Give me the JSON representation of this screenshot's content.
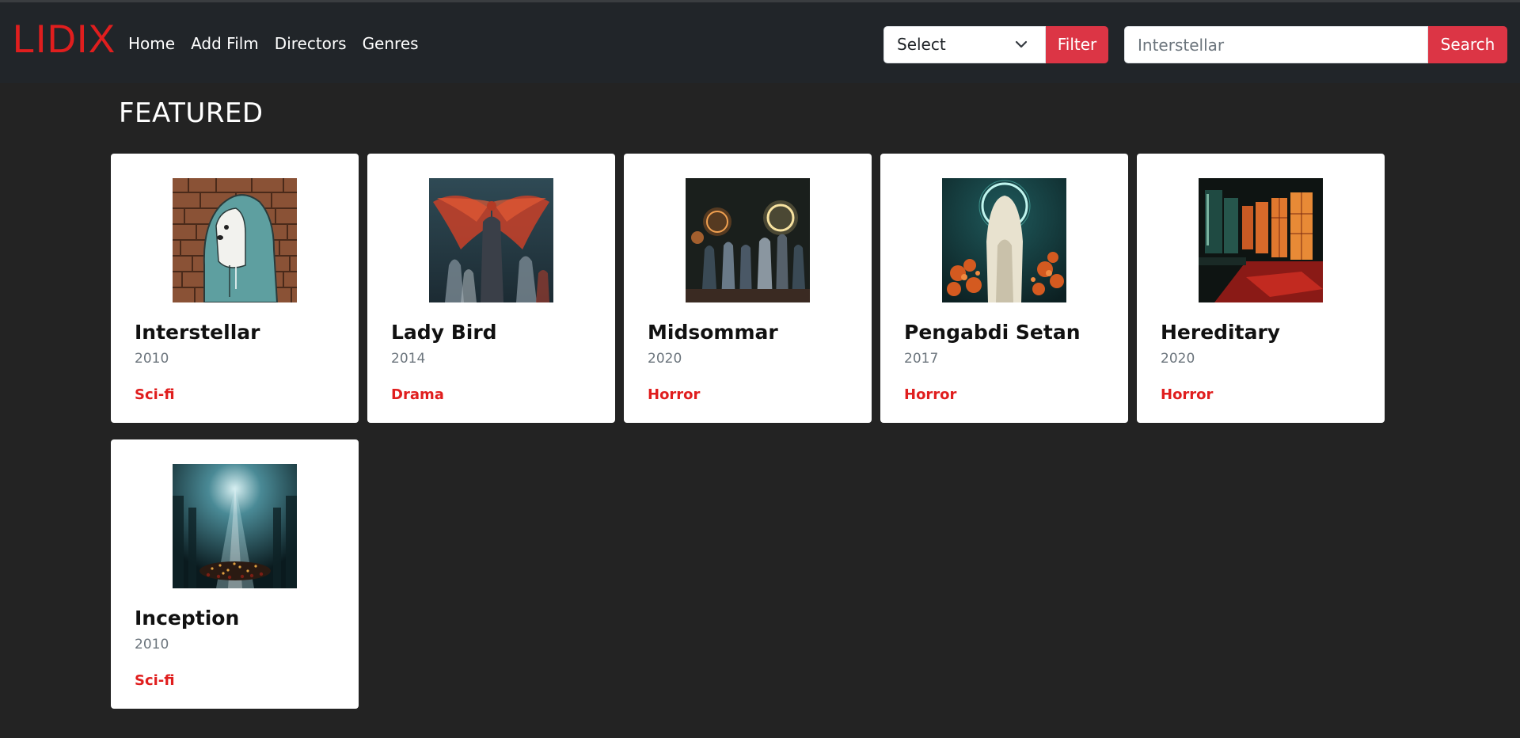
{
  "brand": "LIDIX",
  "nav": {
    "links": [
      "Home",
      "Add Film",
      "Directors",
      "Genres"
    ]
  },
  "filter": {
    "selected": "Select",
    "button": "Filter"
  },
  "search": {
    "value": "Interstellar",
    "button": "Search"
  },
  "section_title": "FEATURED",
  "colors": {
    "accent": "#dc3545",
    "brand": "#e01e1e",
    "background": "#232323",
    "navbar": "#212529"
  },
  "films": [
    {
      "title": "Interstellar",
      "year": "2010",
      "genre": "Sci-fi",
      "poster": "hooded-bear"
    },
    {
      "title": "Lady Bird",
      "year": "2014",
      "genre": "Drama",
      "poster": "winged-figure"
    },
    {
      "title": "Midsommar",
      "year": "2020",
      "genre": "Horror",
      "poster": "ritual-procession"
    },
    {
      "title": "Pengabdi Setan",
      "year": "2017",
      "genre": "Horror",
      "poster": "haloed-ghost"
    },
    {
      "title": "Hereditary",
      "year": "2020",
      "genre": "Horror",
      "poster": "red-corridor"
    },
    {
      "title": "Inception",
      "year": "2010",
      "genre": "Sci-fi",
      "poster": "light-cathedral"
    }
  ]
}
